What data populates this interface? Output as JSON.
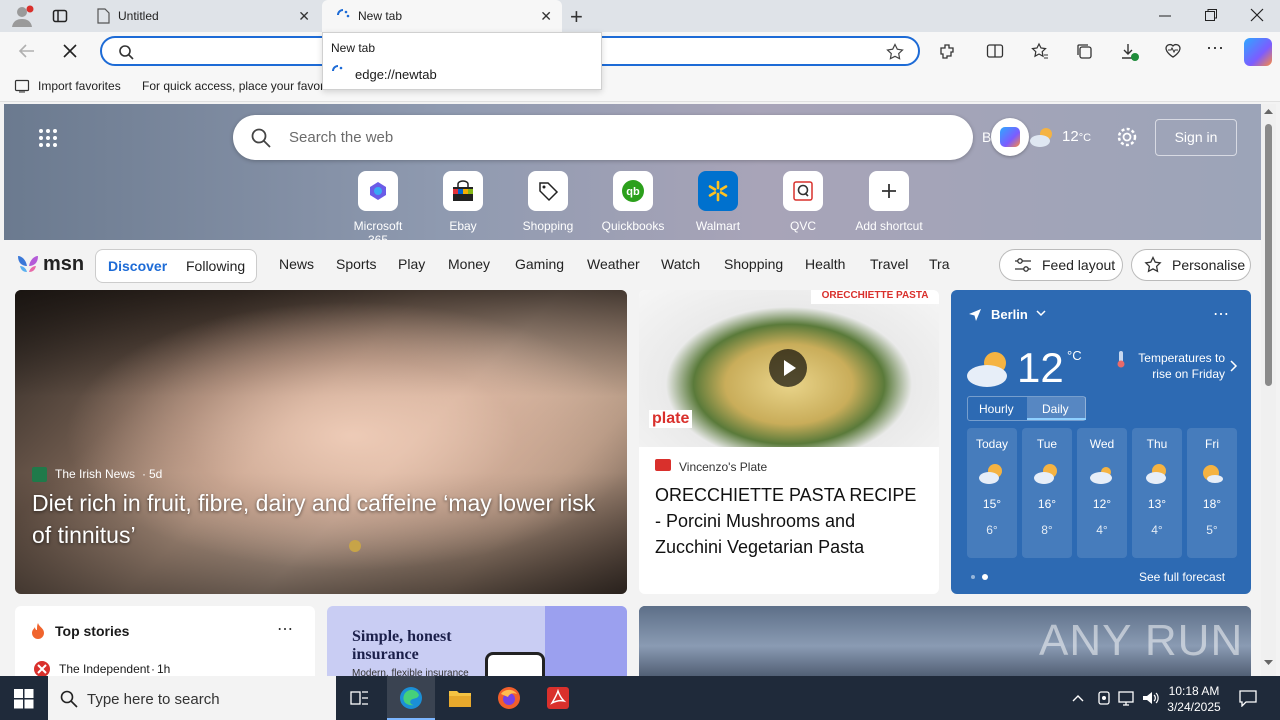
{
  "browser": {
    "tabs": [
      {
        "label": "Untitled"
      },
      {
        "label": "New tab"
      }
    ],
    "address": {
      "value": ""
    },
    "dropdown": {
      "title": "New tab",
      "url": "edge://newtab"
    },
    "favorites_bar": {
      "import_label": "Import favorites",
      "hint": "For quick access, place your favori"
    }
  },
  "page": {
    "search": {
      "placeholder": "Search the web"
    },
    "weather_top": {
      "city": "Berlin",
      "temp": "12",
      "unit": "°C"
    },
    "sign_in": "Sign in",
    "shortcuts": [
      {
        "label": "Microsoft 365"
      },
      {
        "label": "Ebay"
      },
      {
        "label": "Shopping"
      },
      {
        "label": "Quickbooks"
      },
      {
        "label": "Walmart"
      },
      {
        "label": "QVC"
      },
      {
        "label": "Add shortcut"
      }
    ],
    "nav": {
      "logo": "msn",
      "discover": "Discover",
      "following": "Following",
      "items": [
        "News",
        "Sports",
        "Play",
        "Money",
        "Gaming",
        "Weather",
        "Watch",
        "Shopping",
        "Health",
        "Travel",
        "Tra"
      ],
      "feed_layout": "Feed layout",
      "personalise": "Personalise"
    },
    "main_story": {
      "source": "The Irish News",
      "age": "5d",
      "headline": "Diet rich in fruit, fibre, dairy and caffeine ‘may lower risk of tinnitus’"
    },
    "pasta_story": {
      "banner": "ORECCHIETTE PASTA",
      "badge": "plate",
      "source": "Vincenzo's Plate",
      "headline": "ORECCHIETTE PASTA RECIPE - Porcini Mushrooms and Zucchini Vegetarian Pasta"
    },
    "weather_card": {
      "city": "Berlin",
      "temp": "12",
      "unit": "°C",
      "note_line1": "Temperatures to",
      "note_line2": "rise on Friday",
      "tab_hourly": "Hourly",
      "tab_daily": "Daily",
      "days": [
        {
          "day": "Today",
          "high": "15°",
          "low": "6°"
        },
        {
          "day": "Tue",
          "high": "16°",
          "low": "8°"
        },
        {
          "day": "Wed",
          "high": "12°",
          "low": "4°"
        },
        {
          "day": "Thu",
          "high": "13°",
          "low": "4°"
        },
        {
          "day": "Fri",
          "high": "18°",
          "low": "5°"
        }
      ],
      "see_full": "See full forecast"
    },
    "top_stories": {
      "title": "Top stories",
      "source": "The Independent",
      "age": "1h"
    },
    "insurance": {
      "line1": "Simple, honest",
      "line2": "insurance",
      "line3": "Modern, flexible insurance"
    },
    "watermark": "ANY RUN"
  },
  "taskbar": {
    "search_placeholder": "Type here to search",
    "time": "10:18 AM",
    "date": "3/24/2025"
  }
}
